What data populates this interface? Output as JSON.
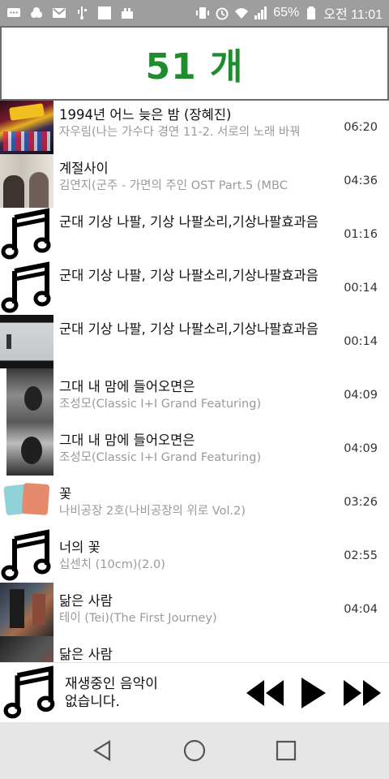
{
  "status_bar": {
    "battery_percent": "65%",
    "time": "오전 11:01",
    "icons": [
      "chat-icon",
      "cloud-icon",
      "gmail-icon",
      "usb-icon",
      "square-icon",
      "dock-icon",
      "vibrate-icon",
      "alarm-icon",
      "wifi-icon",
      "signal-icon",
      "battery-icon"
    ]
  },
  "header": {
    "count_label": "51 개",
    "color": "#1f8c2e"
  },
  "songs": [
    {
      "title": "1994년 어느 늦은 밤 (장혜진)",
      "subtitle": "자우림(나는 가수다  경연 11-2. 서로의 노래 바꿔",
      "duration": "06:20",
      "art": "concert"
    },
    {
      "title": "계절사이",
      "subtitle": "김연지(군주 - 가면의 주인 OST Part.5 (MBC",
      "duration": "04:36",
      "art": "drama"
    },
    {
      "title": "군대 기상 나팔, 기상 나팔소리,기상나팔효과음",
      "subtitle": "",
      "duration": "01:16",
      "art": "music-note"
    },
    {
      "title": "군대 기상 나팔, 기상 나팔소리,기상나팔효과음",
      "subtitle": "",
      "duration": "00:14",
      "art": "music-note"
    },
    {
      "title": "군대 기상 나팔, 기상 나팔소리,기상나팔효과음",
      "subtitle": "",
      "duration": "00:14",
      "art": "misty"
    },
    {
      "title": "그대 내 맘에 들어오면은",
      "subtitle": "조성모(Classic I+I Grand Featuring)",
      "duration": "04:09",
      "art": "tall"
    },
    {
      "title": "그대 내 맘에 들어오면은",
      "subtitle": "조성모(Classic I+I Grand Featuring)",
      "duration": "04:09",
      "art": "tall"
    },
    {
      "title": "꽃",
      "subtitle": "나비공장 2호(나비공장의 위로 Vol.2)",
      "duration": "03:26",
      "art": "flower"
    },
    {
      "title": "너의 꽃",
      "subtitle": "십센치 (10cm)(2.0)",
      "duration": "02:55",
      "art": "music-note"
    },
    {
      "title": "닮은 사람",
      "subtitle": "테이 (Tei)(The First Journey)",
      "duration": "04:04",
      "art": "tei"
    },
    {
      "title": "닮은 사람",
      "subtitle": "",
      "duration": "",
      "art": "partial"
    }
  ],
  "player": {
    "now_playing_text": "재생중인 음악이\n없습니다.",
    "controls": [
      "rewind-icon",
      "play-icon",
      "fast-forward-icon"
    ]
  },
  "nav": {
    "buttons": [
      "back-icon",
      "home-icon",
      "recents-icon"
    ]
  }
}
